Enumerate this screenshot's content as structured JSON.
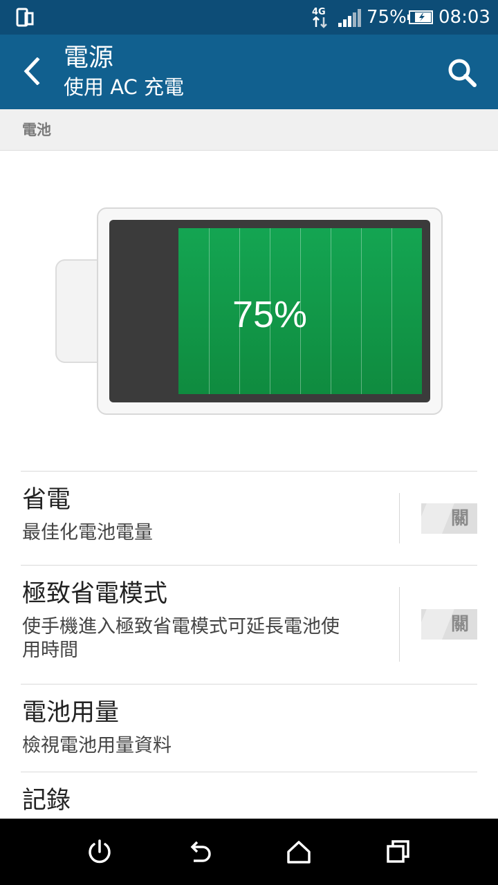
{
  "status_bar": {
    "network_type": "4G",
    "battery_percent": "75%",
    "time": "08:03",
    "icons": [
      "phone-mode-icon",
      "network-4g-icon",
      "signal-icon",
      "battery-charging-icon"
    ]
  },
  "app_bar": {
    "title": "電源",
    "subtitle": "使用 AC 充電",
    "icons": [
      "back-icon",
      "search-icon"
    ]
  },
  "section": {
    "header": "電池"
  },
  "battery_graphic": {
    "level": 0.75,
    "label": "75%",
    "fill_color": "#13a04f"
  },
  "settings": [
    {
      "title": "省電",
      "subtitle": "最佳化電池電量",
      "toggle": "關"
    },
    {
      "title": "極致省電模式",
      "subtitle_line1": "使手機進入極致省電模式可延長電池使",
      "subtitle_line2": "用時間",
      "toggle": "關"
    },
    {
      "title": "電池用量",
      "subtitle": "檢視電池用量資料"
    },
    {
      "title": "記錄"
    }
  ],
  "nav_bar": {
    "icons": [
      "power-icon",
      "back-arrow-icon",
      "home-icon",
      "recents-icon"
    ]
  },
  "colors": {
    "status_bar": "#0d4d77",
    "app_bar": "#11608f",
    "section_header_bg": "#f0f0f0",
    "battery_green": "#13a04f"
  }
}
